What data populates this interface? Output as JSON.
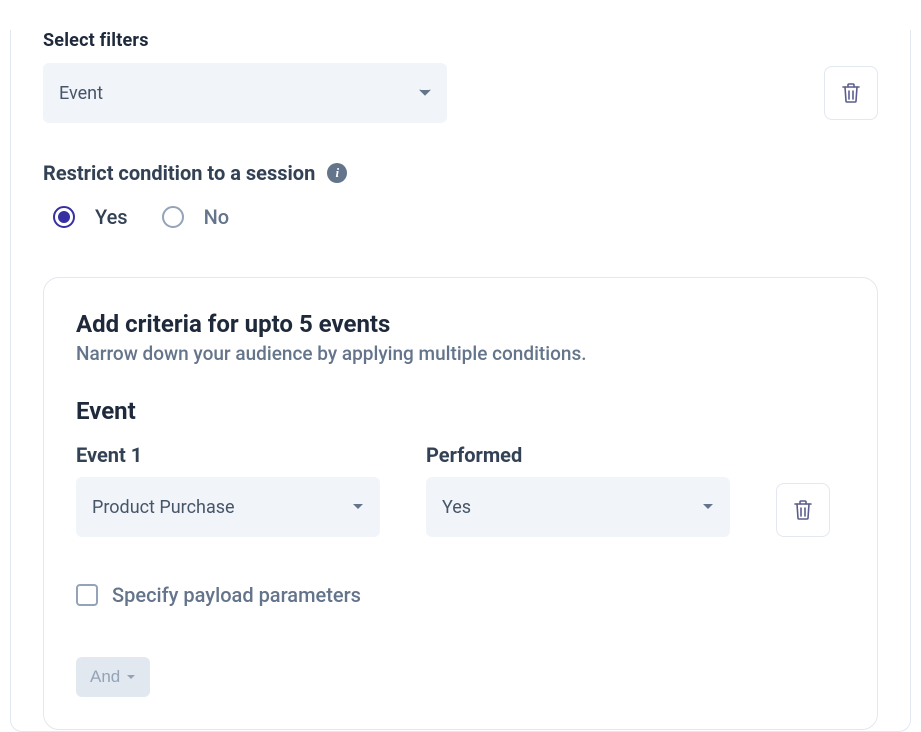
{
  "filters": {
    "section_label": "Select filters",
    "dropdown_value": "Event"
  },
  "restrict": {
    "label": "Restrict condition to a session",
    "options": {
      "yes": "Yes",
      "no": "No"
    },
    "selected": "yes"
  },
  "criteria": {
    "title": "Add criteria for upto 5 events",
    "subtitle": "Narrow down your audience by applying multiple conditions.",
    "event_heading": "Event",
    "event1": {
      "label": "Event 1",
      "value": "Product Purchase"
    },
    "performed": {
      "label": "Performed",
      "value": "Yes"
    },
    "payload_checkbox": {
      "label": "Specify payload parameters",
      "checked": false
    },
    "and_button": "And"
  }
}
